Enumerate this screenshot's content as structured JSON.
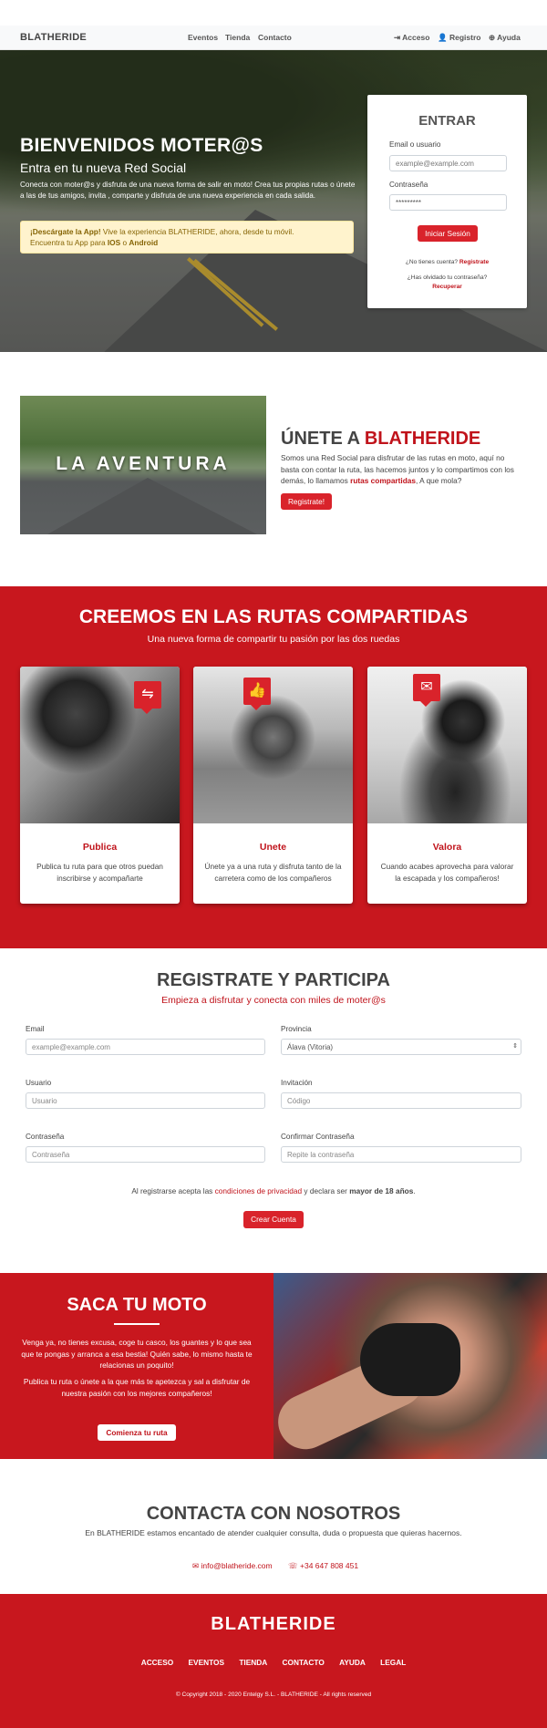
{
  "nav": {
    "brand": "BLATHERIDE",
    "center_links": [
      "Eventos",
      "Tienda",
      "Contacto"
    ],
    "right_links": [
      {
        "icon": "sign-in-icon",
        "label": "Acceso"
      },
      {
        "icon": "user-plus-icon",
        "label": "Registro"
      },
      {
        "icon": "help-icon",
        "label": "Ayuda"
      }
    ]
  },
  "hero": {
    "title": "BIENVENIDOS MOTER@S",
    "subtitle": "Entra en tu nueva Red Social",
    "description": "Conecta con moter@s y disfruta de una nueva forma de salir en moto! Crea tus propias rutas o únete a las de tus amigos, invita , comparte y disfruta de una nueva experiencia en cada salida.",
    "alert_strong": "¡Descárgate la App!",
    "alert_text": " Vive la experiencia BLATHERIDE, ahora, desde tu móvil.",
    "alert_line2_prefix": "Encuentra tu App para ",
    "alert_ios": "IOS",
    "alert_or": " o ",
    "alert_android": "Android"
  },
  "login": {
    "title": "ENTRAR",
    "email_label": "Email o usuario",
    "email_placeholder": "example@example.com",
    "password_label": "Contraseña",
    "password_value": "*********",
    "submit": "Iniciar Sesión",
    "no_account": "¿No tienes cuenta?",
    "register_link": "Registrate",
    "forgot": "¿Has olvidado tu contraseña?",
    "recover_link": "Recuperar"
  },
  "join": {
    "image_text": "LA AVENTURA",
    "title_prefix": "ÚNETE A ",
    "title_brand": "BLATHERIDE",
    "description_1": "Somos una Red Social para disfrutar de las rutas en moto, aquí no basta con contar la ruta, las hacemos juntos y lo compartimos con los demás, lo llamamos ",
    "description_strong": "rutas compartidas",
    "description_2": ", A que mola?",
    "button": "Registrate!"
  },
  "rutas": {
    "title": "CREEMOS EN LAS RUTAS COMPARTIDAS",
    "subtitle": "Una nueva forma de compartir tu pasión por las dos ruedas",
    "cards": [
      {
        "icon": "route-icon",
        "title": "Publica",
        "text": "Publica tu ruta para que otros puedan inscribirse y acompañarte"
      },
      {
        "icon": "thumbs-up-icon",
        "title": "Unete",
        "text": "Únete ya a una ruta y disfruta tanto de la carretera como de los compañeros"
      },
      {
        "icon": "comment-icon",
        "title": "Valora",
        "text": "Cuando acabes aprovecha para valorar la escapada y los compañeros!"
      }
    ]
  },
  "registro": {
    "title": "REGISTRATE Y PARTICIPA",
    "subtitle": "Empieza a disfrutar y conecta con miles de moter@s",
    "email_label": "Email",
    "email_placeholder": "example@example.com",
    "provincia_label": "Provincia",
    "provincia_value": "Álava (Vitoria)",
    "usuario_label": "Usuario",
    "usuario_placeholder": "Usuario",
    "invitacion_label": "Invitación",
    "invitacion_placeholder": "Código",
    "password_label": "Contraseña",
    "password_placeholder": "Contraseña",
    "confirm_label": "Confirmar Contraseña",
    "confirm_placeholder": "Repite la contraseña",
    "legal_prefix": "Al registrarse acepta las ",
    "legal_link": "condiciones de privacidad",
    "legal_mid": " y declara ser ",
    "legal_strong": "mayor de 18 años",
    "legal_end": ".",
    "submit": "Crear Cuenta"
  },
  "saca": {
    "title": "SACA TU MOTO",
    "text_1": "Venga ya, no tienes excusa, coge tu casco, los guantes y lo que sea que te pongas y arranca a esa bestia! Quién sabe, lo mismo hasta te relacionas un poquito!",
    "text_2": "Publica tu ruta o únete a la que más te apetezca y sal a disfrutar de nuestra pasión con los mejores compañeros!",
    "button": "Comienza tu ruta"
  },
  "contacto": {
    "title": "CONTACTA CON NOSOTROS",
    "subtitle": "En BLATHERIDE estamos encantado de atender cualquier consulta, duda o propuesta que quieras hacernos.",
    "email": "info@blatheride.com",
    "phone": "+34 647 808 451"
  },
  "footer": {
    "brand": "BLATHERIDE",
    "links": [
      "ACCESO",
      "EVENTOS",
      "TIENDA",
      "CONTACTO",
      "AYUDA",
      "LEGAL"
    ],
    "copyright": "© Copyright 2018 - 2020 Entelgy S.L. - BLATHERIDE - All rights reserved"
  },
  "colors": {
    "brand_red": "#c8171e",
    "button_red": "#d9232b",
    "alert_bg": "#fff3cd"
  }
}
